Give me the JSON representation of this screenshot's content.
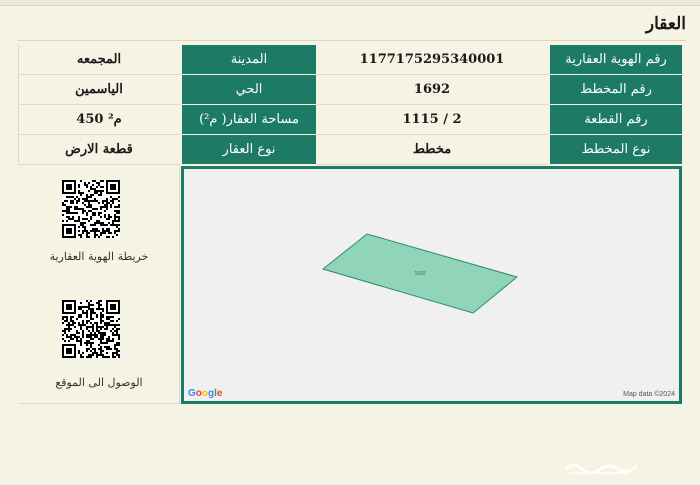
{
  "section_title": "العقار",
  "rows": [
    {
      "label_right": "رقم الهوية العقارية",
      "value_right": "1177175295340001",
      "label_left": "المدينة",
      "value_left": "المجمعه"
    },
    {
      "label_right": "رقم المخطط",
      "value_right": "1692",
      "label_left": "الحي",
      "value_left": "الياسمين"
    },
    {
      "label_right": "رقم القطعة",
      "value_right": "1115 / 2",
      "label_left": "مساحة العقار( م²)",
      "value_left": "450 م²"
    },
    {
      "label_right": "نوع المخطط",
      "value_right": "مخطط",
      "label_left": "نوع العقار",
      "value_left": "قطعة الارض"
    }
  ],
  "qr_codes": [
    {
      "label": "خريطة الهوية العقارية",
      "icon": "qr-code-icon"
    },
    {
      "label": "الوصول الى الموقع",
      "icon": "qr-code-icon"
    }
  ],
  "map": {
    "parcel_label": "1692",
    "logo_text": "Google",
    "credit": "Map data ©2024",
    "colors": {
      "parcel_fill": "#7fcfb0",
      "parcel_stroke": "#2e8b6c",
      "frame": "#1d7a64"
    }
  },
  "watermark": "حراج",
  "colors": {
    "header_green": "#1d7a64",
    "background": "#f5f3e4"
  }
}
